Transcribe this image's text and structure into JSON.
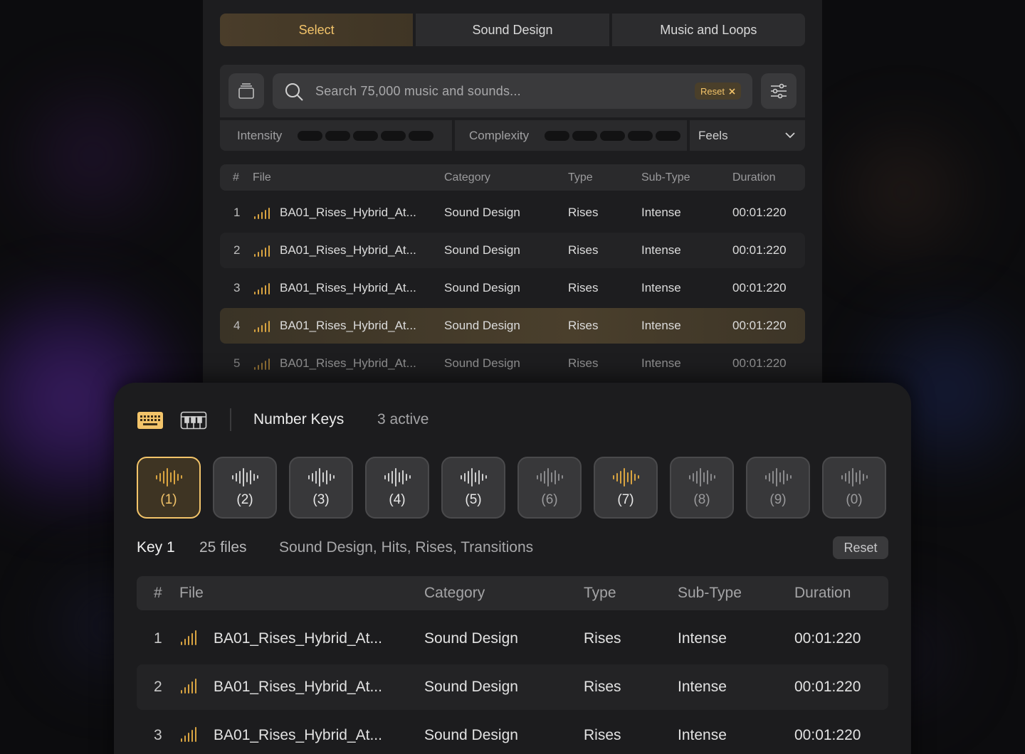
{
  "tabs": [
    {
      "label": "Select",
      "active": true
    },
    {
      "label": "Sound Design",
      "active": false
    },
    {
      "label": "Music and Loops",
      "active": false
    }
  ],
  "search": {
    "placeholder": "Search 75,000 music and sounds...",
    "reset_label": "Reset",
    "library_icon": "stack-icon",
    "filter_icon": "sliders-icon"
  },
  "filters": {
    "intensity_label": "Intensity",
    "complexity_label": "Complexity",
    "feels_label": "Feels"
  },
  "top_table": {
    "columns": [
      "#",
      "File",
      "Category",
      "Type",
      "Sub-Type",
      "Duration"
    ],
    "rows": [
      {
        "num": "1",
        "file": "BA01_Rises_Hybrid_At...",
        "category": "Sound Design",
        "type": "Rises",
        "subtype": "Intense",
        "duration": "00:01:220"
      },
      {
        "num": "2",
        "file": "BA01_Rises_Hybrid_At...",
        "category": "Sound Design",
        "type": "Rises",
        "subtype": "Intense",
        "duration": "00:01:220"
      },
      {
        "num": "3",
        "file": "BA01_Rises_Hybrid_At...",
        "category": "Sound Design",
        "type": "Rises",
        "subtype": "Intense",
        "duration": "00:01:220"
      },
      {
        "num": "4",
        "file": "BA01_Rises_Hybrid_At...",
        "category": "Sound Design",
        "type": "Rises",
        "subtype": "Intense",
        "duration": "00:01:220"
      },
      {
        "num": "5",
        "file": "BA01_Rises_Hybrid_At...",
        "category": "Sound Design",
        "type": "Rises",
        "subtype": "Intense",
        "duration": "00:01:220"
      }
    ]
  },
  "number_keys": {
    "title": "Number Keys",
    "active_count": "3 active",
    "keys": [
      "(1)",
      "(2)",
      "(3)",
      "(4)",
      "(5)",
      "(6)",
      "(7)",
      "(8)",
      "(9)",
      "(0)"
    ]
  },
  "key_info": {
    "key": "Key 1",
    "files": "25 files",
    "categories": "Sound Design, Hits, Rises, Transitions",
    "reset_label": "Reset"
  },
  "bottom_table": {
    "columns": [
      "#",
      "File",
      "Category",
      "Type",
      "Sub-Type",
      "Duration"
    ],
    "rows": [
      {
        "num": "1",
        "file": "BA01_Rises_Hybrid_At...",
        "category": "Sound Design",
        "type": "Rises",
        "subtype": "Intense",
        "duration": "00:01:220"
      },
      {
        "num": "2",
        "file": "BA01_Rises_Hybrid_At...",
        "category": "Sound Design",
        "type": "Rises",
        "subtype": "Intense",
        "duration": "00:01:220"
      },
      {
        "num": "3",
        "file": "BA01_Rises_Hybrid_At...",
        "category": "Sound Design",
        "type": "Rises",
        "subtype": "Intense",
        "duration": "00:01:220"
      }
    ]
  },
  "colors": {
    "accent": "#f3c46a",
    "waveform": "#d9a441",
    "panel": "#1d1d1f"
  }
}
